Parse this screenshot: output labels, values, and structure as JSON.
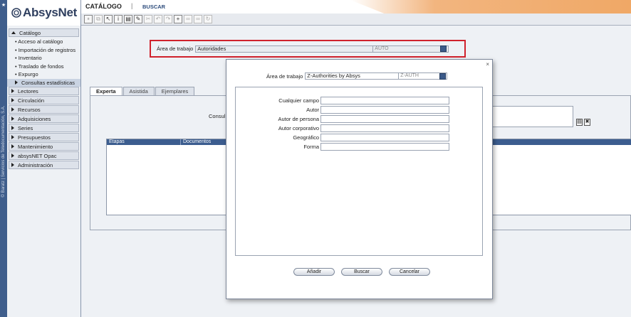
{
  "app": {
    "name": "AbsysNet",
    "vertical_text": "© Baratz | Servicios de Teledocumentación, S.A."
  },
  "topbar": {
    "title": "CATÁLOGO",
    "separator": "|",
    "section": "BUSCAR"
  },
  "toolbar_icons": [
    "new-record-icon",
    "copy-icon",
    "insert-icon",
    "info-icon",
    "save-icon",
    "edit-icon",
    "scissors-icon",
    "undo-icon",
    "redo-icon",
    "add-icon",
    "link-icon",
    "link-icon",
    "refresh-icon"
  ],
  "sidebar": {
    "catalogo": {
      "label": "Catálogo",
      "items": [
        "Acceso al catálogo",
        "Importación de registros",
        "Inventario",
        "Traslado de fondos",
        "Expurgo"
      ],
      "active": "Consultas estadísticas"
    },
    "sections": [
      "Lectores",
      "Circulación",
      "Recursos",
      "Adquisiciones",
      "Series",
      "Presupuestos",
      "Mantenimiento",
      "absysNET Opac",
      "Administración"
    ]
  },
  "main": {
    "work_area": {
      "label": "Área de trabajo",
      "value": "Autoridades",
      "code": "AUTO"
    },
    "tabs": [
      "Experta",
      "Asistida",
      "Ejemplares"
    ],
    "consulta_label": "Consul",
    "grid": {
      "columns": [
        "Etapas",
        "Documentos"
      ]
    }
  },
  "modal": {
    "close": "×",
    "work_area": {
      "label": "Área de trabajo",
      "value": "Z-Authorities by Absys",
      "code": "Z-AUTH"
    },
    "fields": [
      "Cualquier campo",
      "Autor",
      "Autor de persona",
      "Autor corporativo",
      "Geográfico",
      "Forma"
    ],
    "buttons": {
      "add": "Añadir",
      "search": "Buscar",
      "cancel": "Cancelar"
    }
  },
  "colors": {
    "accent": "#3b5a89",
    "highlight_border": "#d0212c",
    "top_orange": "#f0a866"
  }
}
